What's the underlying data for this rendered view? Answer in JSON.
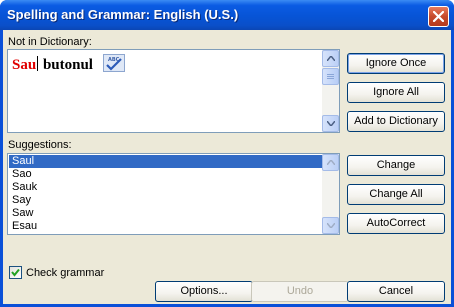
{
  "window": {
    "title": "Spelling and Grammar: English (U.S.)",
    "close_icon": "close-icon",
    "colors": {
      "titlebar": "#0754d6",
      "client": "#ece9d8",
      "selection": "#316ac5",
      "error_text": "#e00000"
    }
  },
  "not_in_dictionary": {
    "label": "Not in Dictionary:",
    "error_word": "Sau",
    "rest_text": " butonul",
    "icon": "spellcheck-abc-icon"
  },
  "suggestions": {
    "label": "Suggestions:",
    "items": [
      "Saul",
      "Sao",
      "Sauk",
      "Say",
      "Saw",
      "Esau"
    ],
    "selected": "Saul"
  },
  "buttons": {
    "ignore_once": "Ignore Once",
    "ignore_all": "Ignore All",
    "add_to_dictionary": "Add to Dictionary",
    "change": "Change",
    "change_all": "Change All",
    "autocorrect": "AutoCorrect",
    "options": "Options...",
    "undo": "Undo",
    "cancel": "Cancel"
  },
  "check_grammar": {
    "label": "Check grammar",
    "checked": true
  }
}
